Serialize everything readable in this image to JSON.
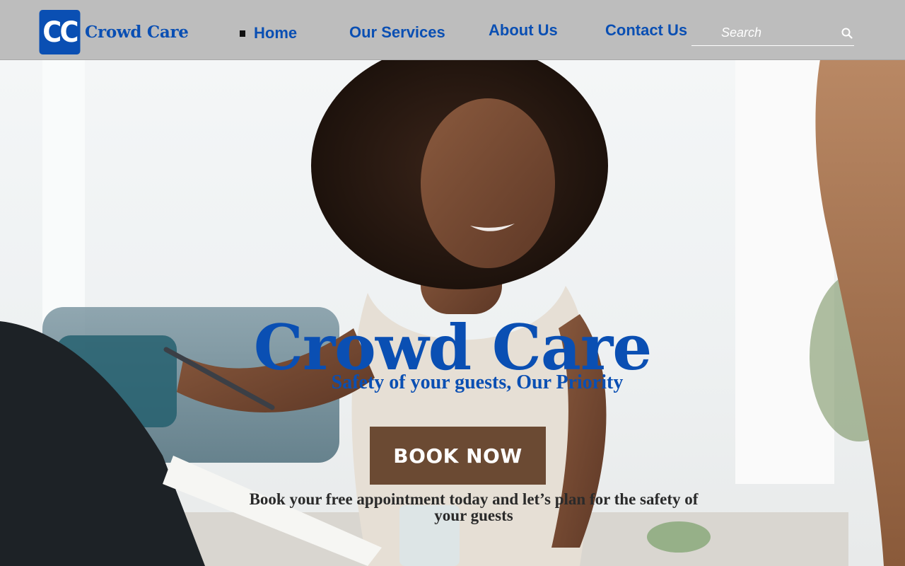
{
  "header": {
    "logo_mark": "CC",
    "logo_text": "Crowd Care",
    "brand_color": "#0a4fb3",
    "background_color": "#bdbdbd"
  },
  "nav": {
    "items": [
      {
        "label": "Home",
        "active": true
      },
      {
        "label": "Our Services"
      },
      {
        "label": "About Us"
      },
      {
        "label": "Contact Us"
      }
    ]
  },
  "search": {
    "placeholder": "Search",
    "icon": "search-icon"
  },
  "hero": {
    "title": "Crowd Care",
    "subtitle": "Safety of your guests, Our Priority",
    "button_label": "BOOK NOW",
    "button_color": "#6b4a33",
    "cta_text": "Book your free appointment today and let’s plan for the safety of your guests"
  }
}
